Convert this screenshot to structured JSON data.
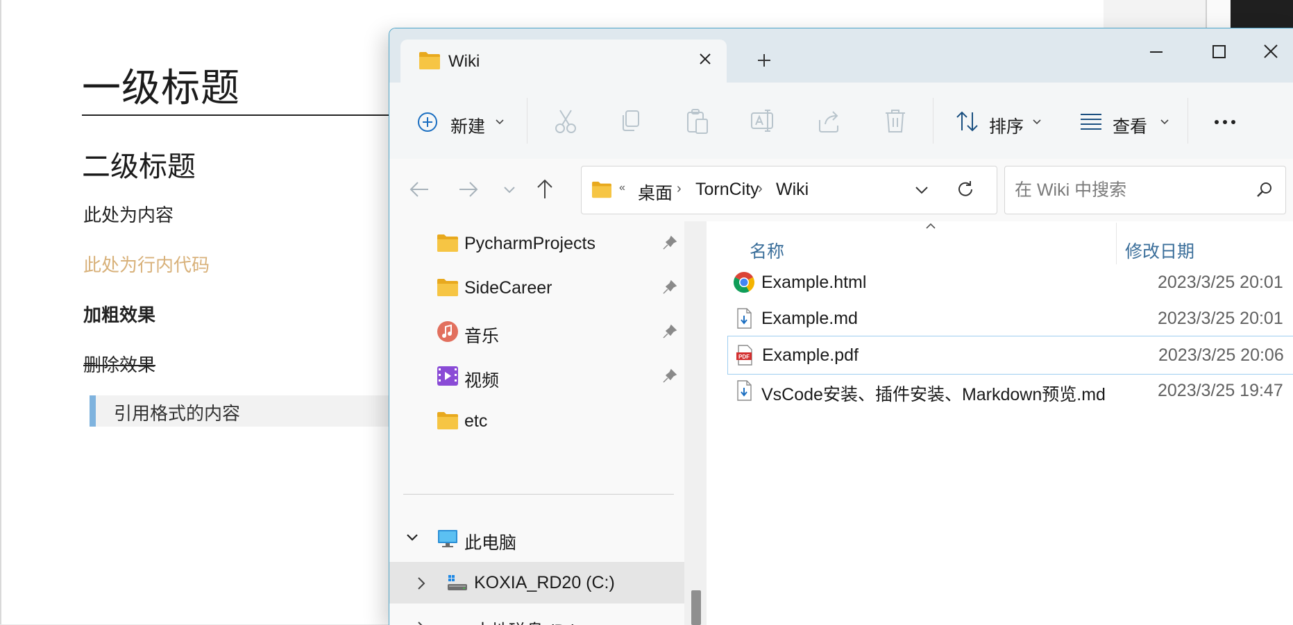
{
  "document": {
    "h1": "一级标题",
    "h2": "二级标题",
    "paragraph": "此处为内容",
    "inline_code": "此处为行内代码",
    "bold": "加粗效果",
    "strikethrough": "删除效果",
    "blockquote": "引用格式的内容"
  },
  "explorer": {
    "tab_title": "Wiki",
    "toolbar": {
      "new_label": "新建",
      "sort_label": "排序",
      "view_label": "查看"
    },
    "breadcrumb": [
      "桌面",
      "TornCity",
      "Wiki"
    ],
    "search_placeholder": "在 Wiki 中搜索",
    "nav_items": [
      {
        "label": "PycharmProjects",
        "icon": "folder-icon",
        "pinned": true
      },
      {
        "label": "SideCareer",
        "icon": "folder-icon",
        "pinned": true
      },
      {
        "label": "音乐",
        "icon": "music-icon",
        "pinned": true
      },
      {
        "label": "视频",
        "icon": "video-icon",
        "pinned": true
      },
      {
        "label": "etc",
        "icon": "folder-icon",
        "pinned": false
      }
    ],
    "this_pc": {
      "label": "此电脑",
      "drives": [
        {
          "label": "KOXIA_RD20 (C:)",
          "selected": true
        },
        {
          "label": "本地磁盘 (D:)",
          "selected": false
        }
      ]
    },
    "columns": {
      "name": "名称",
      "date": "修改日期"
    },
    "files": [
      {
        "name": "Example.html",
        "date": "2023/3/25 20:01",
        "icon": "chrome-icon"
      },
      {
        "name": "Example.md",
        "date": "2023/3/25 20:01",
        "icon": "markdown-file-icon"
      },
      {
        "name": "Example.pdf",
        "date": "2023/3/25 20:06",
        "icon": "pdf-icon",
        "selected": true
      },
      {
        "name": "VsCode安装、插件安装、Markdown预览.md",
        "date": "2023/3/25 19:47",
        "icon": "markdown-file-icon"
      }
    ],
    "colors": {
      "accent": "#4aa3c7",
      "inline_code": "#d8b17a",
      "quote_bar": "#7fb3de",
      "folder": "#f6c544"
    }
  }
}
